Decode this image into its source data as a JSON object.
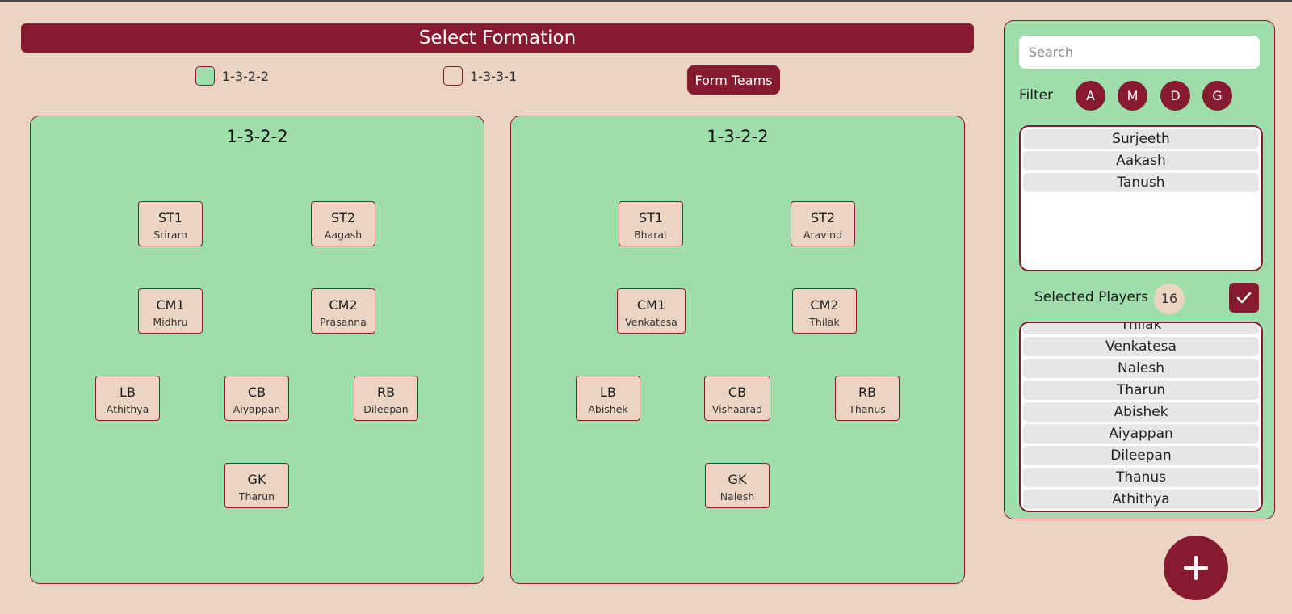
{
  "header": {
    "title": "Select Formation"
  },
  "formation_options": [
    {
      "label": "1-3-2-2",
      "checked": true
    },
    {
      "label": "1-3-3-1",
      "checked": false
    }
  ],
  "form_teams_label": "Form Teams",
  "team1": {
    "formation": "1-3-2-2",
    "positions": [
      {
        "code": "ST1",
        "name": "Sriram"
      },
      {
        "code": "ST2",
        "name": "Aagash"
      },
      {
        "code": "CM1",
        "name": "Midhru"
      },
      {
        "code": "CM2",
        "name": "Prasanna"
      },
      {
        "code": "LB",
        "name": "Athithya"
      },
      {
        "code": "CB",
        "name": "Aiyappan"
      },
      {
        "code": "RB",
        "name": "Dileepan"
      },
      {
        "code": "GK",
        "name": "Tharun"
      }
    ]
  },
  "team2": {
    "formation": "1-3-2-2",
    "positions": [
      {
        "code": "ST1",
        "name": "Bharat"
      },
      {
        "code": "ST2",
        "name": "Aravind"
      },
      {
        "code": "CM1",
        "name": "Venkatesa"
      },
      {
        "code": "CM2",
        "name": "Thilak"
      },
      {
        "code": "LB",
        "name": "Abishek"
      },
      {
        "code": "CB",
        "name": "Vishaarad"
      },
      {
        "code": "RB",
        "name": "Thanus"
      },
      {
        "code": "GK",
        "name": "Nalesh"
      }
    ]
  },
  "sidebar": {
    "search_placeholder": "Search",
    "filter_label": "Filter",
    "filters": [
      "A",
      "M",
      "D",
      "G"
    ],
    "available_players": [
      "Surjeeth",
      "Aakash",
      "Tanush"
    ],
    "selected_label": "Selected Players",
    "selected_count": "16",
    "selected_players": [
      "Thilak",
      "Venkatesa",
      "Nalesh",
      "Tharun",
      "Abishek",
      "Aiyappan",
      "Dileepan",
      "Thanus",
      "Athithya"
    ]
  },
  "icons": {
    "confirm": "check-icon",
    "add": "plus-icon"
  },
  "colors": {
    "accent": "#861a2f",
    "field": "#9ddeab",
    "background": "#ecd4c3"
  }
}
